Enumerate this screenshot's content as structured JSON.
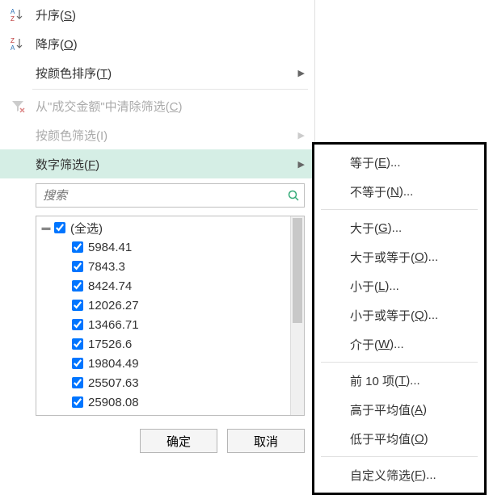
{
  "menu": {
    "sort_asc": "升序(S)",
    "sort_desc": "降序(O)",
    "sort_by_color": "按颜色排序(T)",
    "clear_filter": "从\"成交金额\"中清除筛选(C)",
    "filter_by_color": "按颜色筛选(I)",
    "number_filters": "数字筛选(F)"
  },
  "search": {
    "placeholder": "搜索"
  },
  "tree": {
    "select_all": "(全选)",
    "items": [
      "5984.41",
      "7843.3",
      "8424.74",
      "12026.27",
      "13466.71",
      "17526.6",
      "19804.49",
      "25507.63",
      "25908.08"
    ]
  },
  "buttons": {
    "ok": "确定",
    "cancel": "取消"
  },
  "submenu": {
    "equals": "等于(E)...",
    "not_equals": "不等于(N)...",
    "greater": "大于(G)...",
    "greater_eq": "大于或等于(O)...",
    "less": "小于(L)...",
    "less_eq": "小于或等于(Q)...",
    "between": "介于(W)...",
    "top10": "前 10 项(T)...",
    "above_avg": "高于平均值(A)",
    "below_avg": "低于平均值(O)",
    "custom": "自定义筛选(F)..."
  }
}
